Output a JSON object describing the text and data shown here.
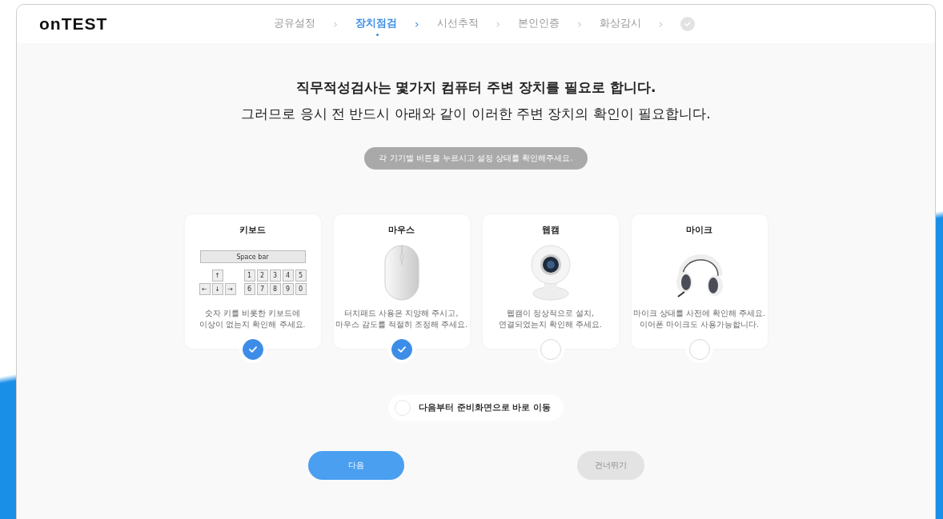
{
  "header": {
    "logo": "onTEST",
    "steps": [
      {
        "label": "공유설정",
        "selected": false
      },
      {
        "label": "장치점검",
        "selected": true
      },
      {
        "label": "시선추적",
        "selected": false
      },
      {
        "label": "본인인증",
        "selected": false
      },
      {
        "label": "화상감시",
        "selected": false
      }
    ],
    "separator": "›",
    "final_step": {
      "selected": false
    }
  },
  "heading": {
    "line1": "직무적성검사는 몇가지 컴퓨터 주변 장치를 필요로 합니다.",
    "line2": "그러므로 응시 전 반드시 아래와 같이 이러한 주변 장치의 확인이 필요합니다."
  },
  "hint": "각 기기별 버튼을 누르시고 설정 상태를 확인해주세요.",
  "devices": [
    {
      "kind": "keyboard",
      "title": "키보드",
      "desc": [
        "숫자 키를 비롯한 키보드에",
        "이상이 없는지 확인해 주세요."
      ],
      "checked": true,
      "space_bar": "Space bar",
      "arrow_keys": [
        "↑",
        "←",
        "↓",
        "→"
      ],
      "number_keys": [
        "1",
        "2",
        "3",
        "4",
        "5",
        "6",
        "7",
        "8",
        "9",
        "0"
      ]
    },
    {
      "kind": "mouse",
      "title": "마우스",
      "desc": [
        "터치패드 사용은 지양해 주시고,",
        "마우스 감도를 적절히 조정해 주세요."
      ],
      "checked": true
    },
    {
      "kind": "webcam",
      "title": "웹캠",
      "desc": [
        "웹캠이 정상적으로 설치,",
        "연결되었는지 확인해 주세요."
      ],
      "checked": false
    },
    {
      "kind": "headset",
      "title": "마이크",
      "desc": [
        "마이크 상태를 사전에 확인해 주세요.",
        "이어폰 마이크도 사용가능합니다."
      ],
      "checked": false
    }
  ],
  "skip_option": {
    "label": "다음부터 준비화면으로 바로 이동",
    "checked": false
  },
  "buttons": {
    "next": {
      "label": "다음",
      "disabled": false
    },
    "skip": {
      "label": "건너뛰기",
      "disabled": true
    }
  }
}
